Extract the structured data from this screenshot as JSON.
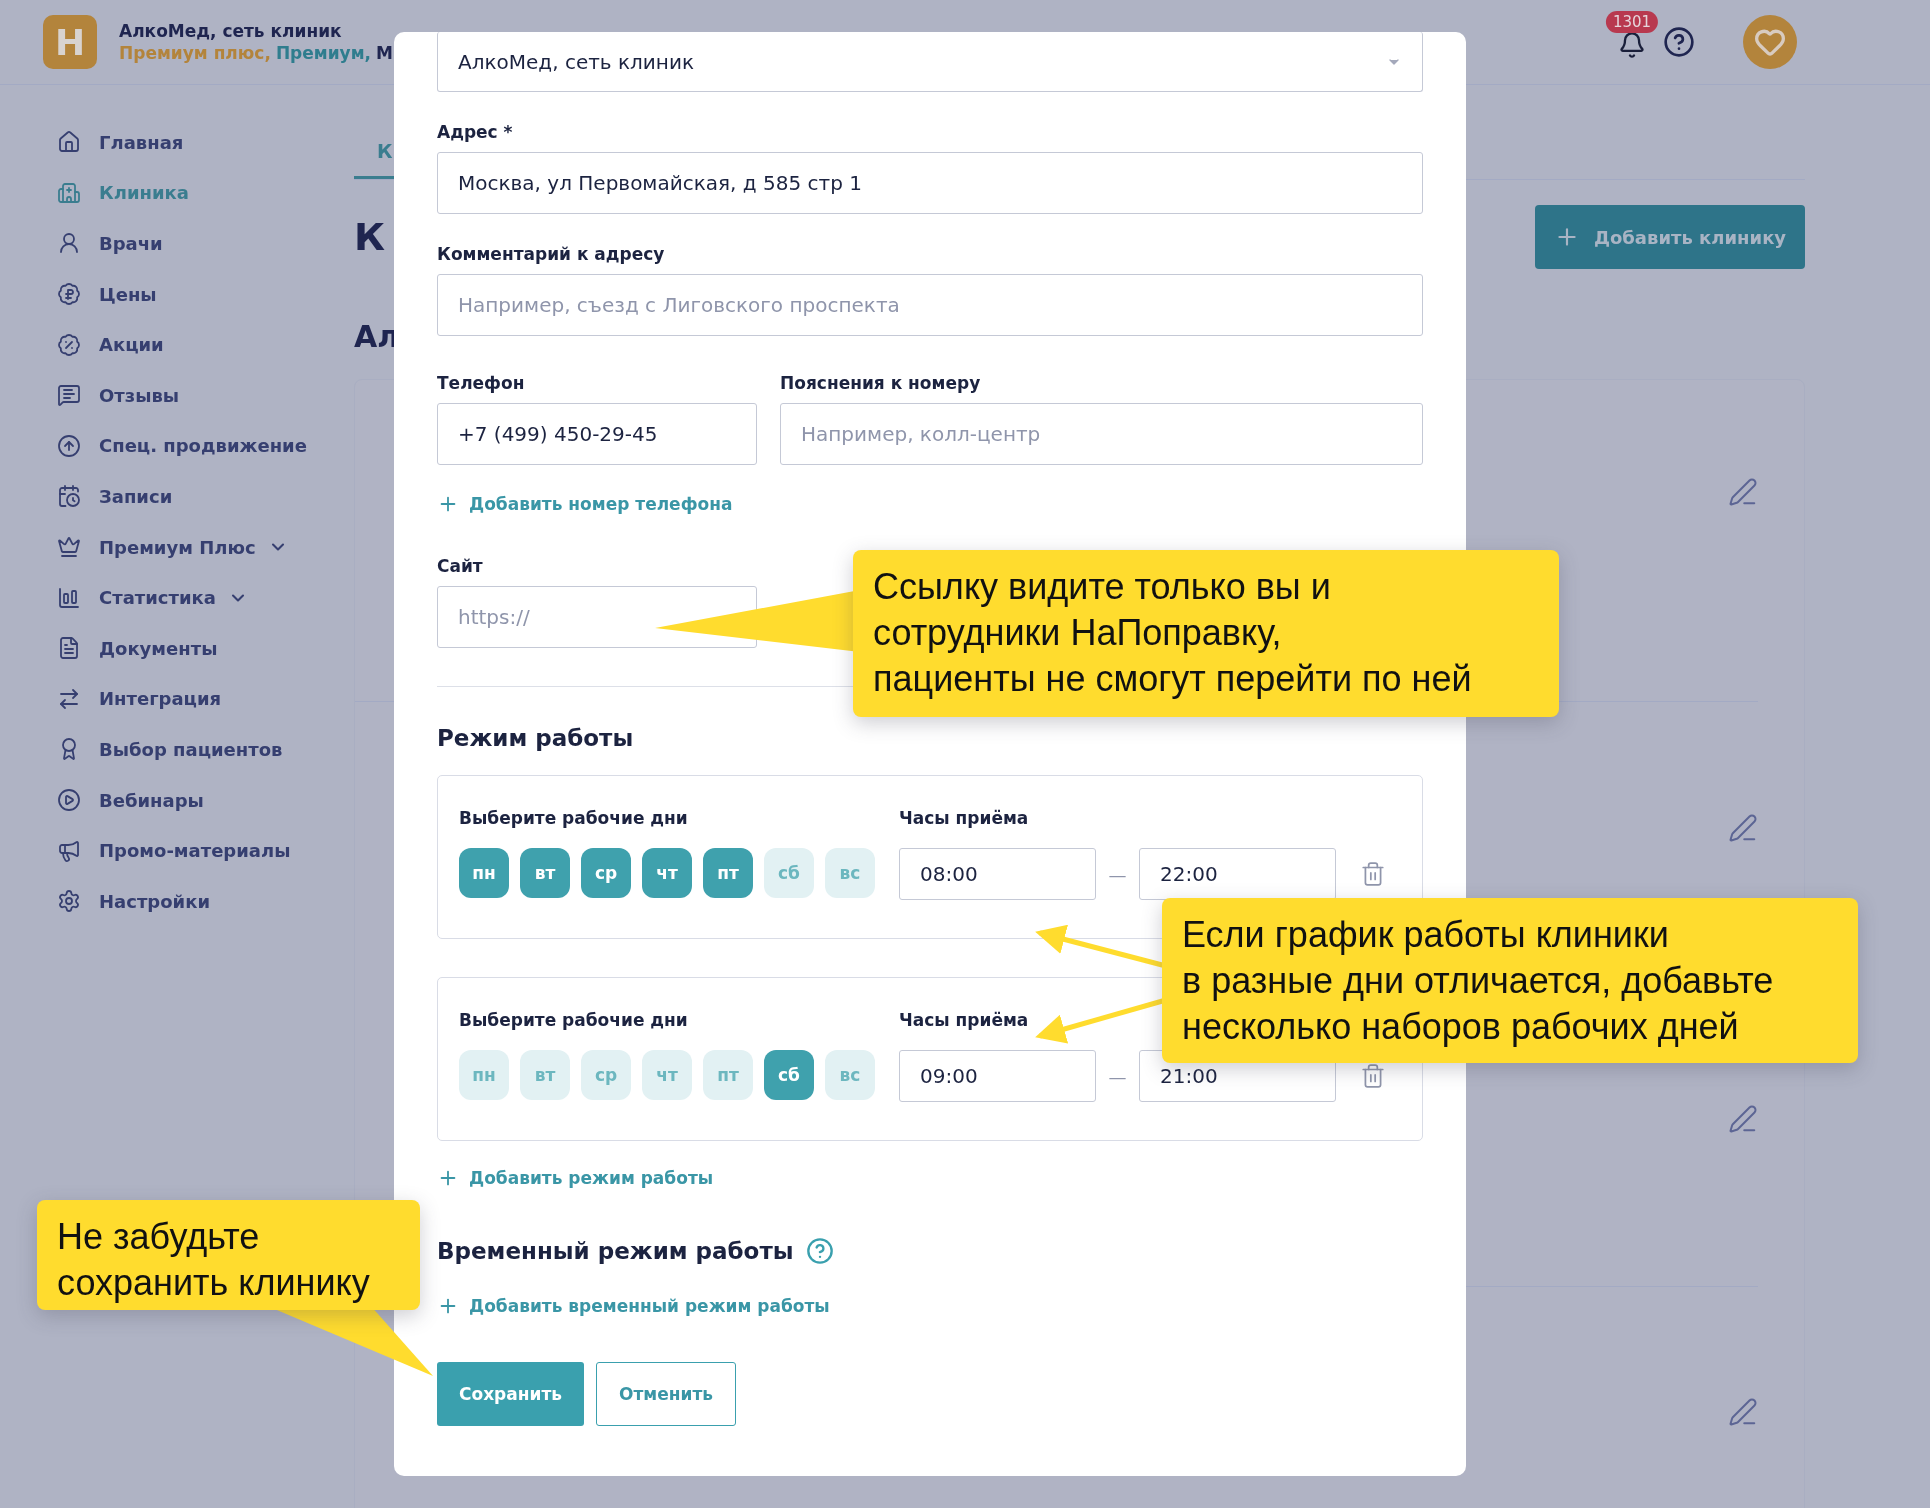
{
  "header": {
    "logo_letter": "H",
    "brand": "АлкоМед, сеть клиник",
    "plans": [
      {
        "label": "Премиум плюс,",
        "color": "#b3843c"
      },
      {
        "label": "Премиум,",
        "color": "#2f7d8e"
      },
      {
        "label": "М",
        "color": "#1f2550"
      }
    ],
    "notifications": "1301"
  },
  "sidebar": {
    "items": [
      {
        "label": "Главная",
        "kind": "link",
        "selected": false
      },
      {
        "label": "Клиника",
        "kind": "link",
        "selected": true
      },
      {
        "label": "Врачи",
        "kind": "link",
        "selected": false
      },
      {
        "label": "Цены",
        "kind": "link",
        "selected": false
      },
      {
        "label": "Акции",
        "kind": "link",
        "selected": false
      },
      {
        "label": "Отзывы",
        "kind": "link",
        "selected": false
      },
      {
        "label": "Спец. продвижение",
        "kind": "link",
        "selected": false
      },
      {
        "label": "Записи",
        "kind": "link",
        "selected": false
      },
      {
        "label": "Премиум Плюс",
        "kind": "group",
        "selected": false
      },
      {
        "label": "Статистика",
        "kind": "group",
        "selected": false
      },
      {
        "label": "Документы",
        "kind": "link",
        "selected": false
      },
      {
        "label": "Интеграция",
        "kind": "link",
        "selected": false
      },
      {
        "label": "Выбор пациентов",
        "kind": "link",
        "selected": false
      },
      {
        "label": "Вебинары",
        "kind": "link",
        "selected": false
      },
      {
        "label": "Промо-материалы",
        "kind": "link",
        "selected": false
      },
      {
        "label": "Настройки",
        "kind": "link",
        "selected": false
      }
    ]
  },
  "page": {
    "tab": "К",
    "title": "К",
    "subtitle": "Ал",
    "add_button": "Добавить клинику"
  },
  "modal": {
    "network": {
      "value": "АлкоМед, сеть клиник"
    },
    "address": {
      "label": "Адрес *",
      "value": "Москва, ул Первомайская, д 585 стр 1"
    },
    "address_comment": {
      "label": "Комментарий к адресу",
      "placeholder": "Например, съезд с Лиговского проспекта"
    },
    "phone": {
      "label": "Телефон",
      "value": "+7 (499) 450-29-45"
    },
    "phone_note": {
      "label": "Пояснения к номеру",
      "placeholder": "Например, колл-центр"
    },
    "add_phone": "Добавить номер телефона",
    "site": {
      "label": "Сайт",
      "placeholder": "https://"
    },
    "schedule_title": "Режим работы",
    "schedules": [
      {
        "days_label": "Выберите рабочие дни",
        "hours_label": "Часы приёма",
        "from": "08:00",
        "dash": "—",
        "to": "22:00",
        "days": [
          {
            "label": "пн",
            "selected": true
          },
          {
            "label": "вт",
            "selected": true
          },
          {
            "label": "ср",
            "selected": true
          },
          {
            "label": "чт",
            "selected": true
          },
          {
            "label": "пт",
            "selected": true
          },
          {
            "label": "сб",
            "selected": false
          },
          {
            "label": "вс",
            "selected": false
          }
        ]
      },
      {
        "days_label": "Выберите рабочие дни",
        "hours_label": "Часы приёма",
        "from": "09:00",
        "dash": "—",
        "to": "21:00",
        "days": [
          {
            "label": "пн",
            "selected": false
          },
          {
            "label": "вт",
            "selected": false
          },
          {
            "label": "ср",
            "selected": false
          },
          {
            "label": "чт",
            "selected": false
          },
          {
            "label": "пт",
            "selected": false
          },
          {
            "label": "сб",
            "selected": true
          },
          {
            "label": "вс",
            "selected": false
          }
        ]
      }
    ],
    "add_schedule": "Добавить режим работы",
    "temp_title": "Временный режим работы",
    "add_temp": "Добавить временный режим работы",
    "save": "Сохранить",
    "cancel": "Отменить"
  },
  "callouts": [
    {
      "text": "Ссылку видите только вы и\nсотрудники НаПоправку,\nпациенты не смогут перейти по ней"
    },
    {
      "text": "Если график работы клиники\nв разные дни отличается, добавьте\nнесколько наборов рабочих дней"
    },
    {
      "text": "Не забудьте\nсохранить клинику"
    }
  ]
}
